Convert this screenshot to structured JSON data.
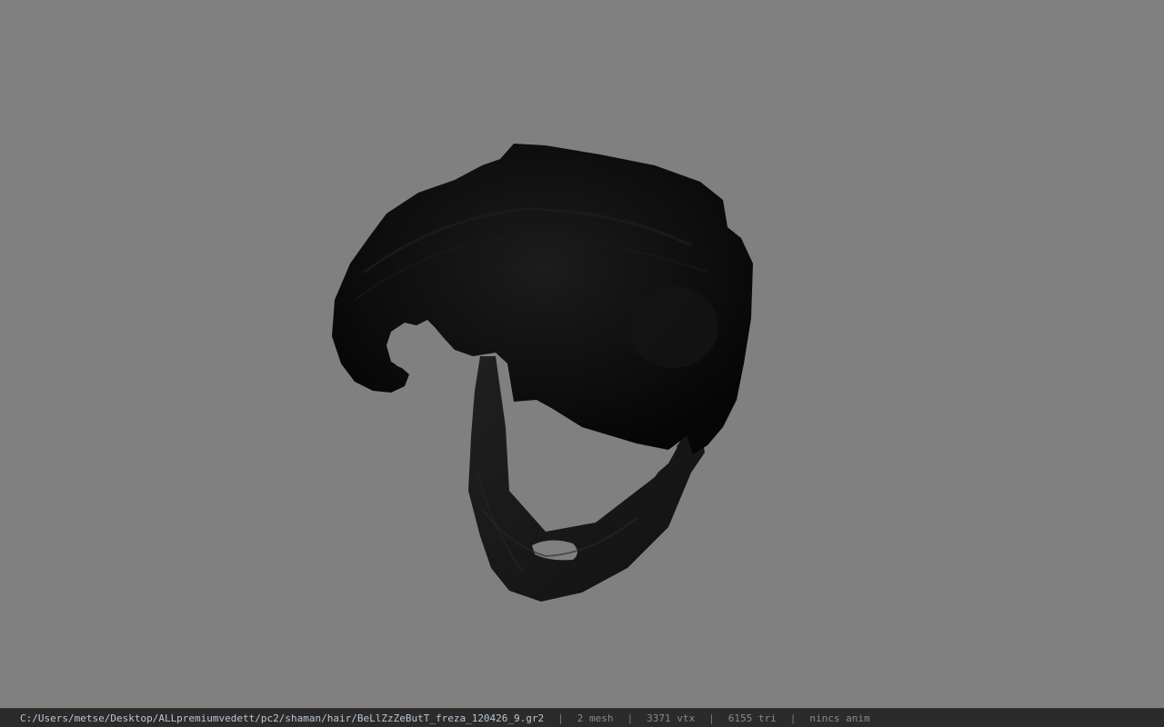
{
  "viewport": {
    "background": "#808080",
    "model_color": "#0d0d0d",
    "subject": "hair model"
  },
  "statusbar": {
    "file_path": "C:/Users/metse/Desktop/ALLpremiumvedett/pc2/shaman/hair/BeLlZzZeButT_freza_120426_9.gr2",
    "separator": "|",
    "mesh": "2 mesh",
    "vertices": "3371 vtx",
    "triangles": "6155 tri",
    "animation": "nincs anim"
  }
}
